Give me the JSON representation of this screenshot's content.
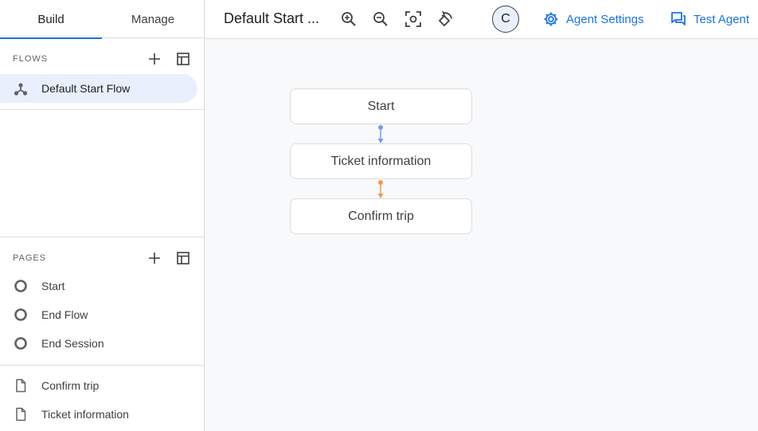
{
  "sidebar": {
    "tabs": [
      {
        "label": "Build"
      },
      {
        "label": "Manage"
      }
    ],
    "flows": {
      "title": "FLOWS",
      "items": [
        {
          "label": "Default Start Flow"
        }
      ]
    },
    "pages": {
      "title": "PAGES",
      "special": [
        {
          "label": "Start"
        },
        {
          "label": "End Flow"
        },
        {
          "label": "End Session"
        }
      ],
      "items": [
        {
          "label": "Confirm trip"
        },
        {
          "label": "Ticket information"
        }
      ]
    }
  },
  "topbar": {
    "flow_title": "Default Start ...",
    "avatar_initial": "C",
    "agent_settings_label": "Agent Settings",
    "test_agent_label": "Test Agent"
  },
  "canvas": {
    "nodes": [
      {
        "label": "Start"
      },
      {
        "label": "Ticket information"
      },
      {
        "label": "Confirm trip"
      }
    ]
  },
  "colors": {
    "accent": "#1a73e8",
    "edge_blue": "#6ea0e8",
    "edge_orange": "#f29a4a",
    "selected_bg": "#e8f0fe"
  }
}
